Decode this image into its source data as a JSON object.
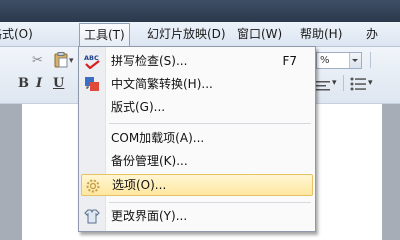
{
  "menubar": {
    "items": [
      {
        "label": "格式(O)"
      },
      {
        "label": "工具(T)"
      },
      {
        "label": "幻灯片放映(D)"
      },
      {
        "label": "窗口(W)"
      },
      {
        "label": "帮助(H)"
      },
      {
        "label": "办"
      }
    ]
  },
  "toolbar": {
    "bold_label": "B",
    "italic_label": "I",
    "underline_label": "U",
    "zoom_value": "%"
  },
  "menu": {
    "items": [
      {
        "label": "拼写检查(S)...",
        "shortcut": "F7",
        "icon": "spellcheck-icon"
      },
      {
        "label": "中文简繁转换(H)...",
        "icon": "chinese-conversion-icon"
      },
      {
        "label": "版式(G)..."
      },
      {
        "label": "COM加载项(A)..."
      },
      {
        "label": "备份管理(K)..."
      },
      {
        "label": "选项(O)...",
        "icon": "options-gear-icon",
        "highlighted": true
      },
      {
        "label": "更改界面(Y)...",
        "icon": "change-ui-icon"
      }
    ]
  },
  "colors": {
    "highlight": "#ffe7a0",
    "menubar_bg": "#dbe5f1",
    "workspace": "#a6adb7"
  }
}
